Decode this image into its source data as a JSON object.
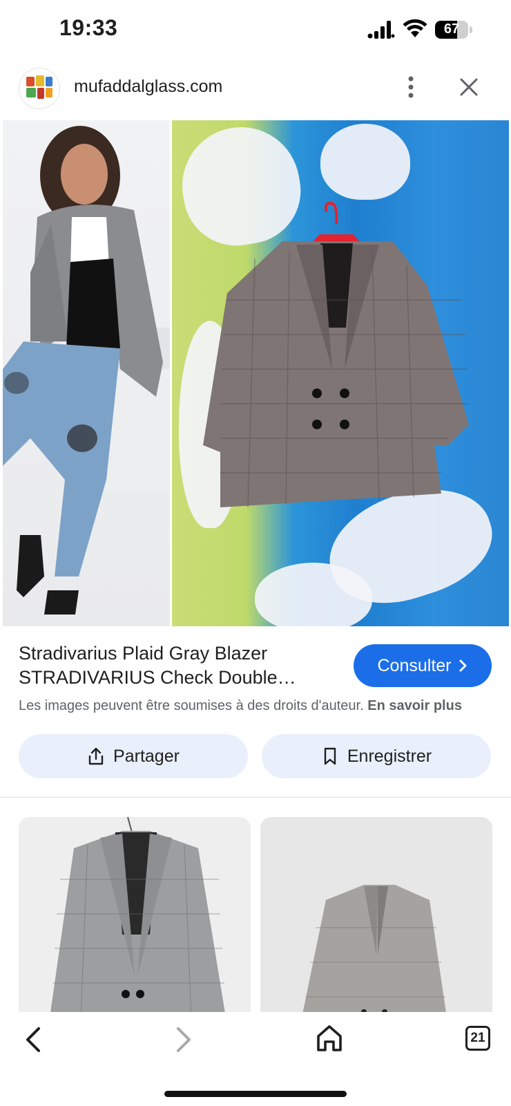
{
  "status_bar": {
    "time": "19:33",
    "battery": "67",
    "battery_level": 0.67
  },
  "header": {
    "site": "mufaddalglass.com"
  },
  "result": {
    "title_line1": "Stradivarius Plaid Gray Blazer",
    "title_line2": "STRADIVARIUS Check Double…",
    "visit_label": "Consulter",
    "copyright_text": "Les images peuvent être soumises à des droits d'auteur.",
    "learn_more": "En savoir plus",
    "share_label": "Partager",
    "save_label": "Enregistrer"
  },
  "bottom_nav": {
    "tab_count": "21"
  },
  "colors": {
    "accent": "#1b6ee8",
    "pill_bg": "#e9f0fb"
  },
  "icons": [
    "signal-icon",
    "wifi-icon",
    "battery-icon",
    "more-vert-icon",
    "close-icon",
    "chevron-right-icon",
    "share-icon",
    "bookmark-icon",
    "back-arrow-icon",
    "forward-arrow-icon",
    "home-icon",
    "tabs-icon"
  ]
}
